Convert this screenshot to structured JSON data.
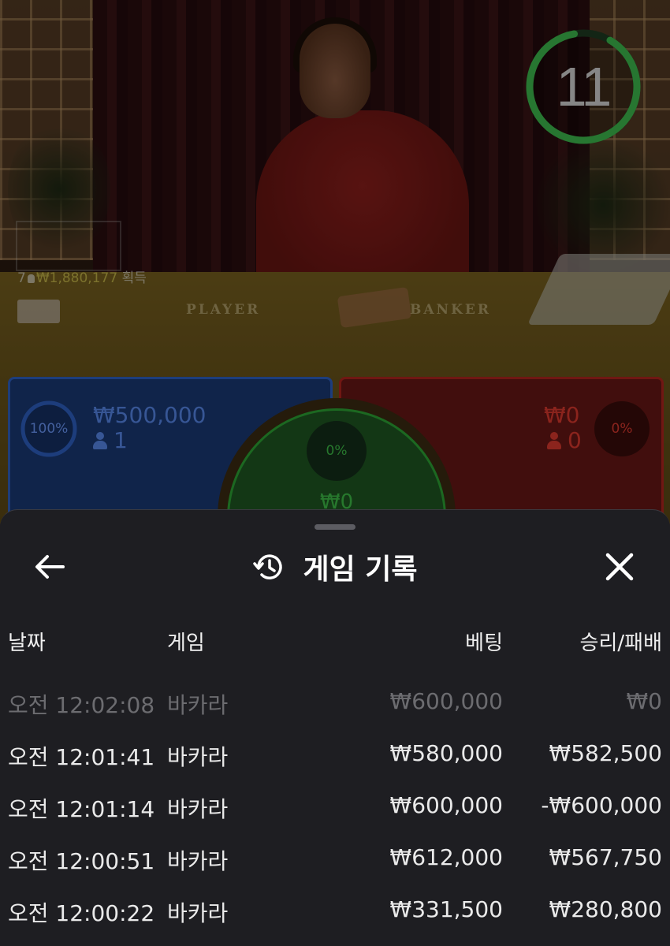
{
  "stream": {
    "countdown": "11",
    "table_labels": {
      "player": "PLAYER",
      "banker": "BANKER"
    },
    "winners": {
      "count": "7",
      "amount": "₩1,880,177",
      "suffix": "획득"
    }
  },
  "bets": {
    "player": {
      "percent_label": "100%",
      "percent": 1.0,
      "amount": "₩500,000",
      "players": "1",
      "color": "#2f63c8"
    },
    "tie": {
      "percent_label": "0%",
      "percent": 0.0,
      "amount": "₩0",
      "color": "#2ea836"
    },
    "banker": {
      "percent_label": "0%",
      "percent": 0.0,
      "amount": "₩0",
      "players": "0",
      "color": "#b5261f"
    }
  },
  "history": {
    "title": "게임 기록",
    "icons": {
      "back": "arrow-left-icon",
      "history": "history-clock-icon",
      "close": "close-icon"
    },
    "columns": {
      "date": "날짜",
      "game": "게임",
      "bet": "베팅",
      "win_loss": "승리/패배"
    },
    "rows": [
      {
        "time": "오전 12:02:08",
        "game": "바카라",
        "bet": "₩600,000",
        "win_loss": "₩0",
        "pending": true
      },
      {
        "time": "오전 12:01:41",
        "game": "바카라",
        "bet": "₩580,000",
        "win_loss": "₩582,500",
        "pending": false
      },
      {
        "time": "오전 12:01:14",
        "game": "바카라",
        "bet": "₩600,000",
        "win_loss": "-₩600,000",
        "pending": false
      },
      {
        "time": "오전 12:00:51",
        "game": "바카라",
        "bet": "₩612,000",
        "win_loss": "₩567,750",
        "pending": false
      },
      {
        "time": "오전 12:00:22",
        "game": "바카라",
        "bet": "₩331,500",
        "win_loss": "₩280,800",
        "pending": false
      }
    ]
  }
}
